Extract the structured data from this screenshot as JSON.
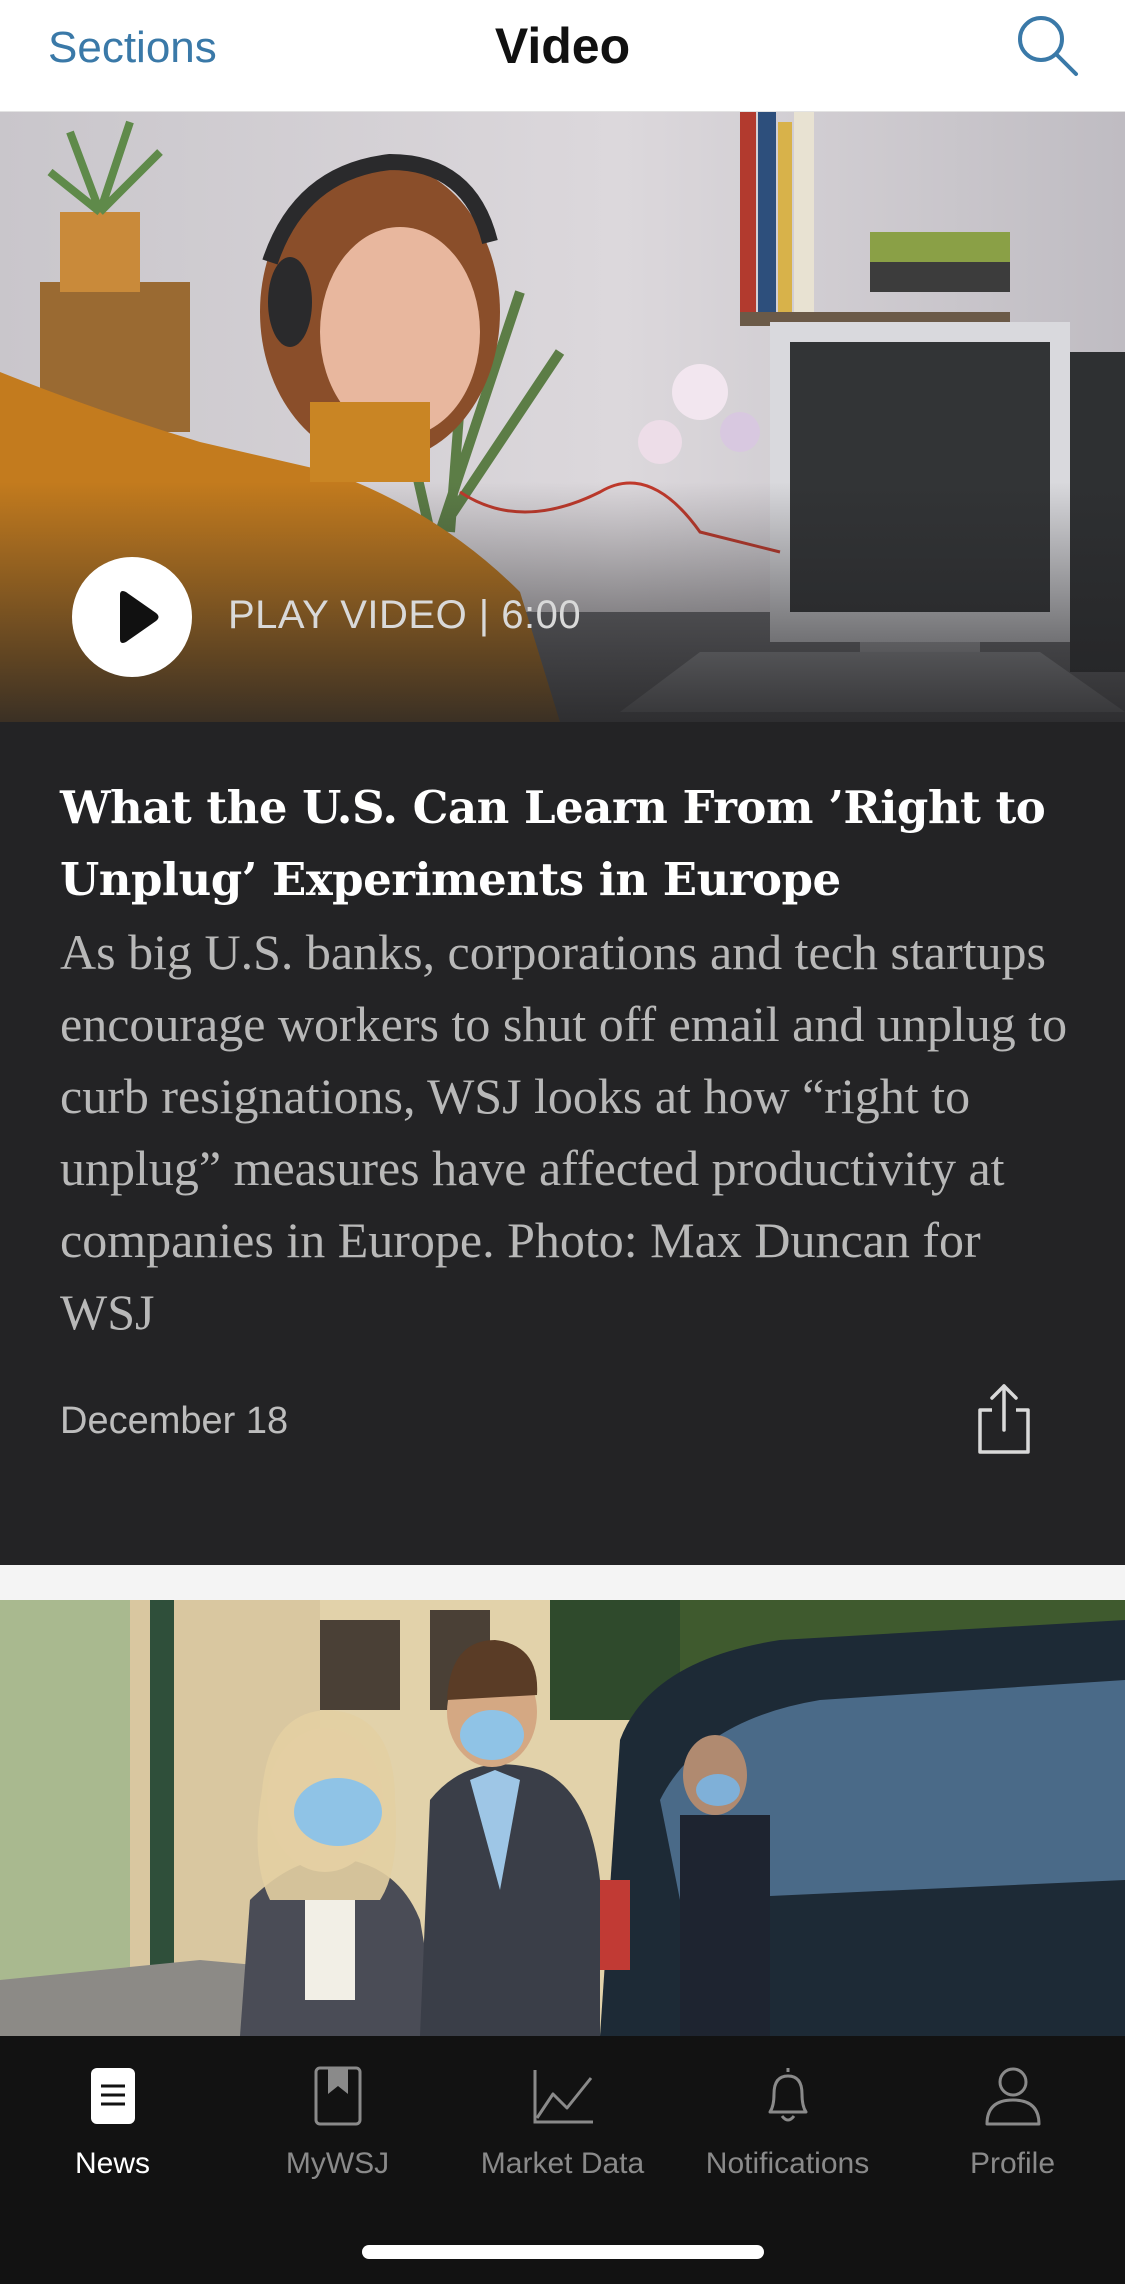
{
  "header": {
    "sections_label": "Sections",
    "title": "Video",
    "search_icon": "search-icon",
    "accent_color": "#3a79a8"
  },
  "featured_video": {
    "play_label": "PLAY VIDEO | 6:00",
    "headline": "What the U.S. Can Learn From ’Right to Unplug’ Experiments in Europe",
    "summary": "As big U.S. banks, corporations and tech startups encourage workers to shut off email and unplug to curb resignations, WSJ looks at how “right to unplug” measures have affected productivity at companies in Europe. Photo: Max Duncan for WSJ",
    "date": "December 18",
    "share_icon": "share-icon",
    "card_background": "#232325"
  },
  "tabbar": {
    "tabs": [
      {
        "label": "News",
        "icon": "newspaper-icon",
        "active": true
      },
      {
        "label": "MyWSJ",
        "icon": "bookmark-icon",
        "active": false
      },
      {
        "label": "Market Data",
        "icon": "line-chart-icon",
        "active": false
      },
      {
        "label": "Notifications",
        "icon": "bell-icon",
        "active": false
      },
      {
        "label": "Profile",
        "icon": "person-icon",
        "active": false
      }
    ]
  }
}
